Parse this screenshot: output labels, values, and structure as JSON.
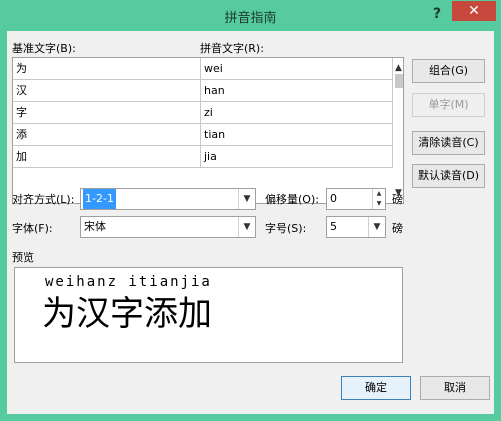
{
  "window": {
    "title": "拼音指南",
    "help": "?",
    "close": "✕"
  },
  "labels": {
    "base_text": "基准文字(B):",
    "pinyin_text": "拼音文字(R):",
    "align": "对齐方式(L):",
    "offset": "偏移量(O):",
    "offset_unit": "磅",
    "font": "字体(F):",
    "size": "字号(S):",
    "size_unit": "磅",
    "preview": "预览"
  },
  "rows": [
    {
      "base": "为",
      "pinyin": "wei"
    },
    {
      "base": "汉",
      "pinyin": "han"
    },
    {
      "base": "字",
      "pinyin": "zi"
    },
    {
      "base": "添",
      "pinyin": "tian"
    },
    {
      "base": "加",
      "pinyin": "jia"
    }
  ],
  "buttons": {
    "combine": "组合(G)",
    "single": "单字(M)",
    "clear": "清除读音(C)",
    "default": "默认读音(D)",
    "ok": "确定",
    "cancel": "取消"
  },
  "fields": {
    "align_value": "1-2-1",
    "offset_value": "0",
    "font_value": "宋体",
    "size_value": "5"
  },
  "preview": {
    "pinyin": "weihanz itianjia",
    "text": "为汉字添加"
  },
  "colors": {
    "frame": "#57cba0",
    "close": "#c7483c",
    "selection": "#3399ff"
  }
}
